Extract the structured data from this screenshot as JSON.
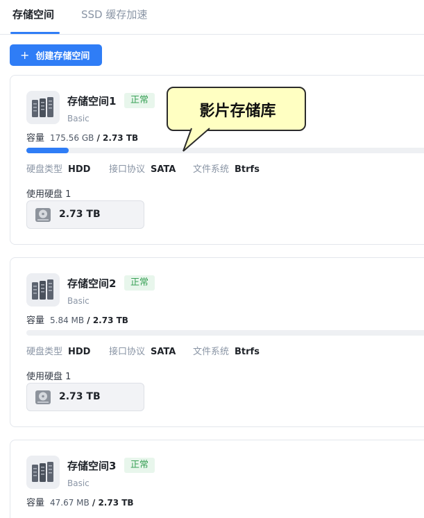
{
  "tabs": [
    {
      "label": "存储空间",
      "active": true
    },
    {
      "label": "SSD 缓存加速",
      "active": false
    }
  ],
  "toolbar": {
    "create_label": "创建存储空间",
    "create_icon": "plus-icon"
  },
  "pools": [
    {
      "name": "存储空间1",
      "status": "正常",
      "type": "Basic",
      "capacity_label": "容量",
      "used": "175.56 GB",
      "separator": "/",
      "total": "2.73 TB",
      "usage_fraction": 0.0628,
      "disk_type_label": "硬盘类型",
      "disk_type": "HDD",
      "interface_label": "接口协议",
      "interface": "SATA",
      "fs_label": "文件系统",
      "fs": "Btrfs",
      "disks_label": "使用硬盘 1",
      "disk_size": "2.73 TB"
    },
    {
      "name": "存储空间2",
      "status": "正常",
      "type": "Basic",
      "capacity_label": "容量",
      "used": "5.84 MB",
      "separator": "/",
      "total": "2.73 TB",
      "usage_fraction": 2e-06,
      "disk_type_label": "硬盘类型",
      "disk_type": "HDD",
      "interface_label": "接口协议",
      "interface": "SATA",
      "fs_label": "文件系统",
      "fs": "Btrfs",
      "disks_label": "使用硬盘 1",
      "disk_size": "2.73 TB"
    },
    {
      "name": "存储空间3",
      "status": "正常",
      "type": "Basic",
      "capacity_label": "容量",
      "used": "47.67 MB",
      "separator": "/",
      "total": "2.73 TB",
      "usage_fraction": 1.7e-05
    }
  ],
  "tooltip": {
    "text": "影片存储库",
    "background": "#ffffc2"
  },
  "colors": {
    "accent": "#2f7df6",
    "status_ok": "#3aa157",
    "status_ok_bg": "#e8f6ec"
  }
}
